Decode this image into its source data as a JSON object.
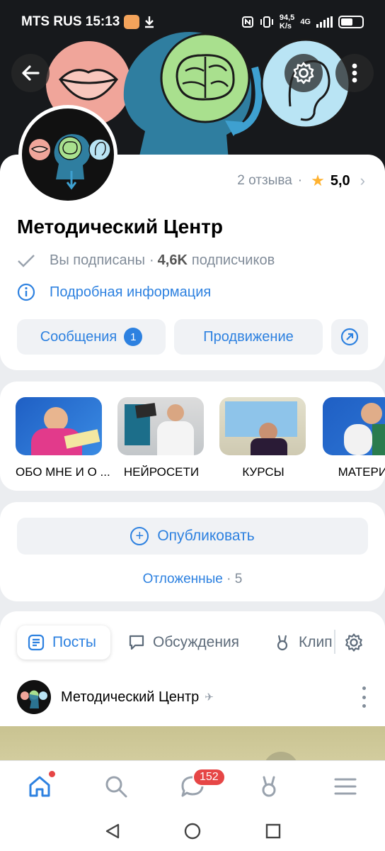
{
  "status_bar": {
    "carrier_time": "MTS RUS 15:13",
    "net_speed": "94,5\nK/s",
    "net_type": "4G"
  },
  "header": {
    "back_icon": "arrow-left-icon",
    "settings_icon": "gear-icon",
    "more_icon": "vertical-dots-icon"
  },
  "profile": {
    "reviews_label": "2 отзыва",
    "rating": "5,0",
    "title": "Методический Центр",
    "subscribed_label": "Вы подписаны",
    "separator": "·",
    "subscribers_count": "4,6K",
    "subscribers_label": "подписчиков",
    "details_link": "Подробная информация",
    "messages_label": "Сообщения",
    "messages_count": "1",
    "promotion_label": "Продвижение"
  },
  "stories": [
    {
      "label": "ОБО МНЕ И О ..."
    },
    {
      "label": "НЕЙРОСЕТИ"
    },
    {
      "label": "КУРСЫ"
    },
    {
      "label": "МАТЕРИА"
    }
  ],
  "publish": {
    "publish_label": "Опубликовать",
    "postponed_label": "Отложенные",
    "postponed_sep": "·",
    "postponed_count": "5"
  },
  "feed": {
    "tabs": [
      {
        "label": "Посты",
        "icon": "document-list-icon",
        "active": true
      },
      {
        "label": "Обсуждения",
        "icon": "chat-bubble-icon",
        "active": false
      },
      {
        "label": "Клип",
        "icon": "clips-icon",
        "active": false
      }
    ],
    "post_author": "Методический Центр"
  },
  "bottom_nav": {
    "messages_badge": "152"
  },
  "colors": {
    "accent": "#2d81e0",
    "secondary_text": "#818c99",
    "badge_red": "#e64646",
    "star": "#ffb230"
  }
}
